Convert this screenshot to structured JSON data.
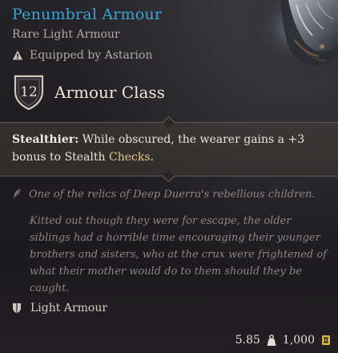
{
  "item": {
    "name": "Penumbral Armour",
    "rarity_type": "Rare Light Armour",
    "equipped_by": "Equipped by Astarion",
    "armour_class_value": "12",
    "armour_class_label": "Armour Class"
  },
  "description": {
    "passive_name": "Stealthier:",
    "passive_text_before": " While obscured, the wearer gains a +3 bonus to Stealth ",
    "passive_keyword": "Checks",
    "passive_text_after": "."
  },
  "lore": {
    "line1": "One of the relics of Deep Duerra's rebellious children.",
    "paragraph": "Kitted out though they were for escape, the older siblings had a horrible time encouraging their younger brothers and sisters, who at the crux were frightened of what their mother would do to them should they be caught."
  },
  "armour_type": "Light Armour",
  "footer": {
    "weight": "5.85",
    "value": "1,000"
  },
  "colors": {
    "rare_title": "#3aa3d6",
    "keyword": "#e3c98c",
    "lore_text": "#8c8680"
  },
  "icons": {
    "equipped": "warning-triangle-icon",
    "armour_class": "shield-icon",
    "lore": "quill-icon",
    "armour_type": "light-armour-icon",
    "weight": "weight-icon",
    "value": "gold-coin-icon"
  }
}
